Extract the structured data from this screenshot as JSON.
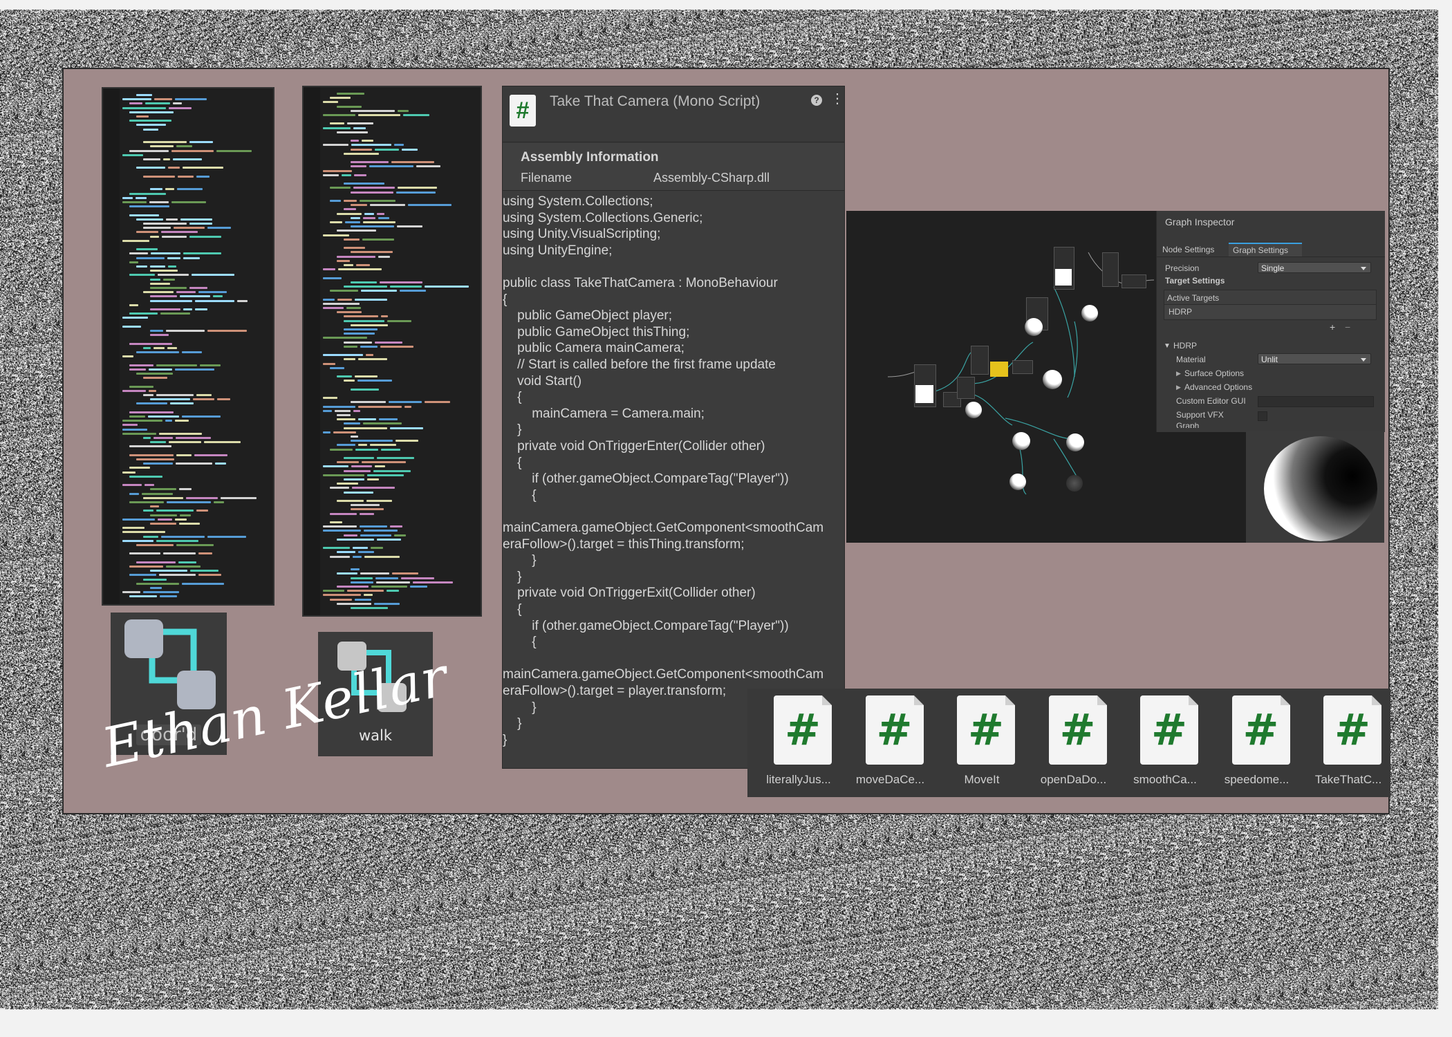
{
  "inspector": {
    "title": "Take That Camera (Mono Script)",
    "script_icon": "#",
    "help_icon": "?",
    "menu_icon": "⋮",
    "assembly_title": "Assembly Information",
    "filename_label": "Filename",
    "filename_value": "Assembly-CSharp.dll",
    "code_lines": [
      "using System.Collections;",
      "using System.Collections.Generic;",
      "using Unity.VisualScripting;",
      "using UnityEngine;",
      "",
      "public class TakeThatCamera : MonoBehaviour",
      "{",
      "    public GameObject player;",
      "    public GameObject thisThing;",
      "    public Camera mainCamera;",
      "    // Start is called before the first frame update",
      "    void Start()",
      "    {",
      "        mainCamera = Camera.main;",
      "    }",
      "    private void OnTriggerEnter(Collider other)",
      "    {",
      "        if (other.gameObject.CompareTag(\"Player\"))",
      "        {",
      "",
      "mainCamera.gameObject.GetComponent<smoothCam",
      "eraFollow>().target = thisThing.transform;",
      "        }",
      "    }",
      "    private void OnTriggerExit(Collider other)",
      "    {",
      "        if (other.gameObject.CompareTag(\"Player\"))",
      "        {",
      "",
      "mainCamera.gameObject.GetComponent<smoothCam",
      "eraFollow>().target = player.transform;",
      "        }",
      "    }",
      "}"
    ]
  },
  "assets": {
    "door": {
      "label": "door'd"
    },
    "walk": {
      "label": "walk"
    }
  },
  "scripts": [
    {
      "label": "literallyJus..."
    },
    {
      "label": "moveDaCe..."
    },
    {
      "label": "MoveIt"
    },
    {
      "label": "openDaDo..."
    },
    {
      "label": "smoothCa..."
    },
    {
      "label": "speedome..."
    },
    {
      "label": "TakeThatC..."
    }
  ],
  "script_glyph": "#",
  "graph_inspector": {
    "title": "Graph Inspector",
    "tabs": [
      "Node Settings",
      "Graph Settings"
    ],
    "active_tab": "Graph Settings",
    "precision_label": "Precision",
    "precision_value": "Single",
    "target_settings": "Target Settings",
    "active_targets": "Active Targets",
    "hdrp_item": "HDRP",
    "add_symbol": "+",
    "remove_symbol": "−",
    "hdrp_section": "HDRP",
    "material_label": "Material",
    "material_value": "Unlit",
    "surface_options": "Surface Options",
    "advanced_options": "Advanced Options",
    "custom_editor_gui": "Custom Editor GUI",
    "support_vfx": "Support VFX",
    "graph_cut": "Graph"
  },
  "signature": "Ethan Kellar",
  "colors": {
    "board": "#a08a8a",
    "script_green": "#1f7a2e",
    "teal": "#4fd8d8",
    "tile_gray": "#b0b6c2"
  }
}
